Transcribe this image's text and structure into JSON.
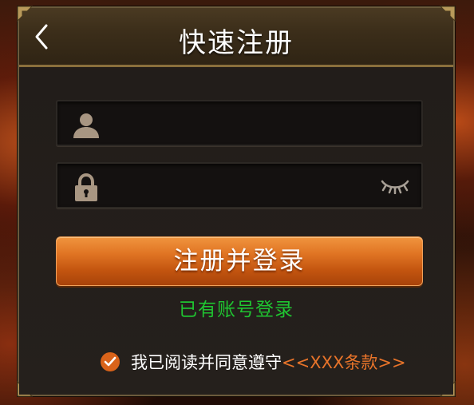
{
  "header": {
    "title": "快速注册"
  },
  "form": {
    "username_value": "",
    "password_value": ""
  },
  "actions": {
    "register_label": "注册并登录",
    "login_link_label": "已有账号登录"
  },
  "agreement": {
    "text": "我已阅读并同意遵守",
    "terms_link": "<<XXX条款>>",
    "checked": true
  },
  "icons": {
    "back": "chevron-left-icon",
    "user": "user-icon",
    "lock": "lock-icon",
    "eye": "eye-closed-icon",
    "check": "check-circle-icon"
  },
  "colors": {
    "accent_orange": "#e07423",
    "link_green": "#1fc431",
    "terms_orange": "#e8742a",
    "panel_bg": "#231d19",
    "header_gold": "#8a6f3c"
  }
}
